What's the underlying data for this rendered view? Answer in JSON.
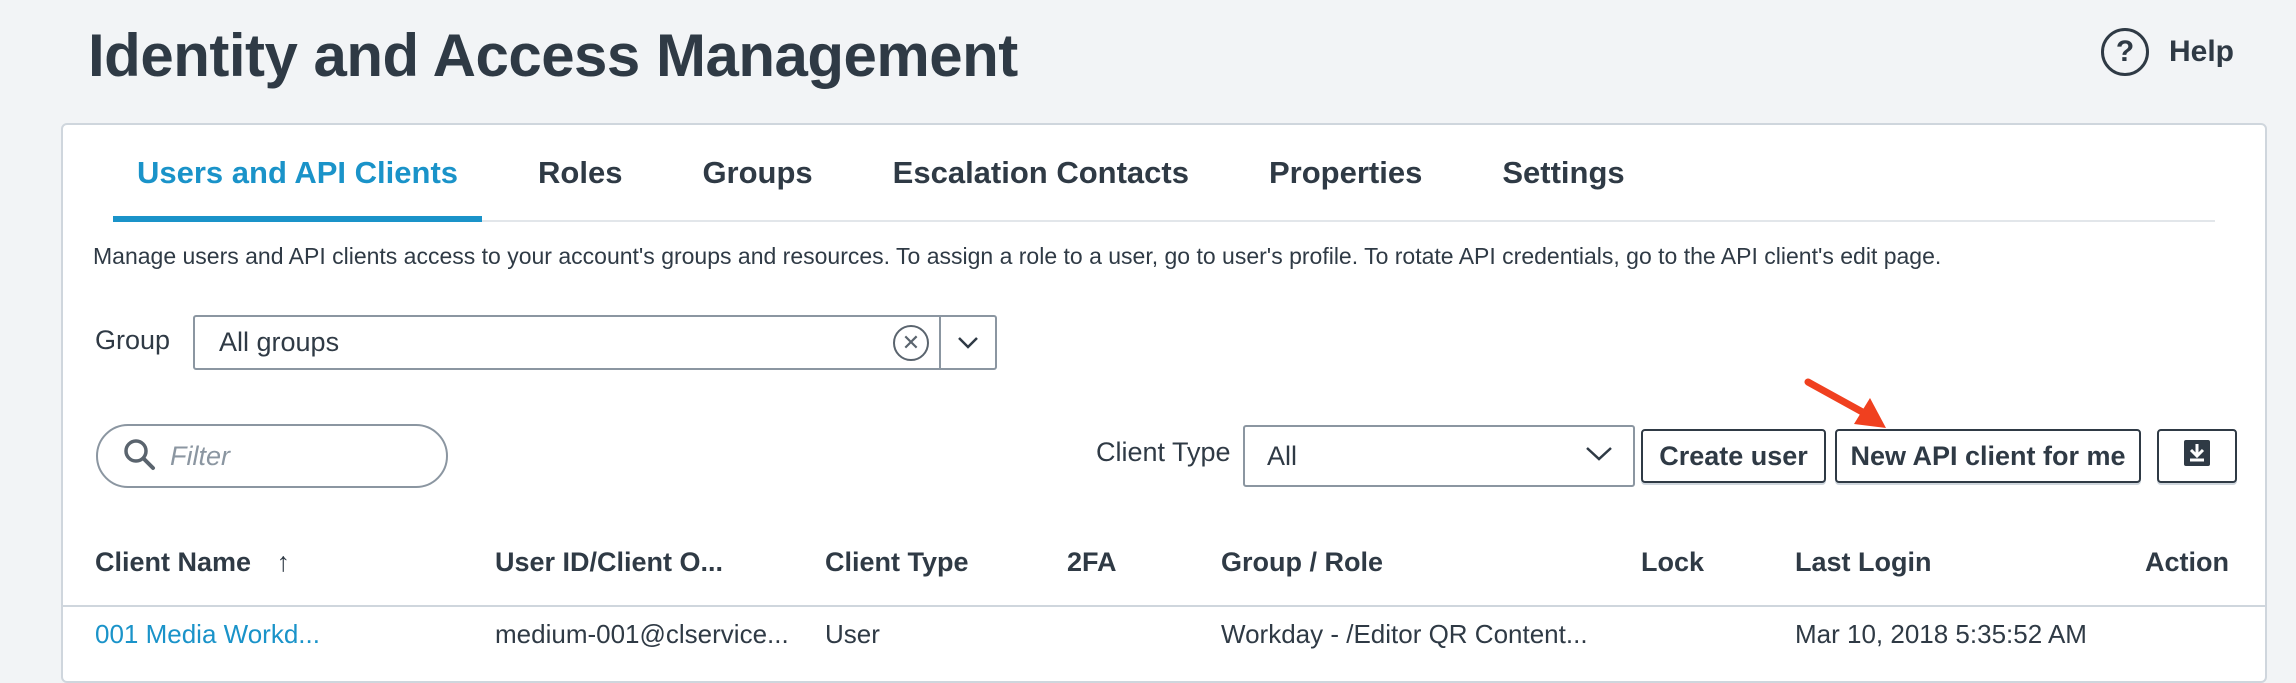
{
  "header": {
    "title": "Identity and Access Management",
    "help_label": "Help",
    "help_icon_glyph": "?"
  },
  "tabs": [
    {
      "label": "Users and API Clients",
      "active": true
    },
    {
      "label": "Roles"
    },
    {
      "label": "Groups"
    },
    {
      "label": "Escalation Contacts"
    },
    {
      "label": "Properties"
    },
    {
      "label": "Settings"
    }
  ],
  "description": "Manage users and API clients access to your account's groups and resources. To assign a role to a user, go to user's profile. To rotate API credentials, go to the API client's edit page.",
  "group_filter": {
    "label": "Group",
    "value": "All groups",
    "clear_glyph": "✕"
  },
  "toolbar": {
    "filter_placeholder": "Filter",
    "client_type_label": "Client Type",
    "client_type_value": "All",
    "create_user_label": "Create user",
    "new_api_client_label": "New API client for me"
  },
  "table": {
    "columns": [
      "Client Name",
      "User ID/Client O...",
      "Client Type",
      "2FA",
      "Group / Role",
      "Lock",
      "Last Login",
      "Action"
    ],
    "sort_glyph": "↑",
    "rows": [
      [
        "001 Media Workd...",
        "medium-001@clservice...",
        "User",
        "",
        "Workday - /Editor QR Content...",
        "",
        "Mar 10, 2018 5:35:52 AM",
        ""
      ]
    ]
  },
  "colors": {
    "accent": "#1a93c9",
    "text": "#2f3a45",
    "background": "#f2f4f6",
    "annotation_arrow": "#f0401f"
  }
}
